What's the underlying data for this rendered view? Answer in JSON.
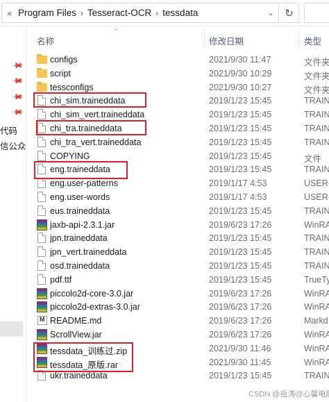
{
  "address_bar": {
    "crumbs": [
      "Program Files",
      "Tesseract-OCR",
      "tessdata"
    ],
    "back_glyph": "«",
    "separator": "›"
  },
  "nav_pane": {
    "texts": [
      "代码",
      "信公众"
    ]
  },
  "columns": {
    "name": "名称",
    "date": "修改日期",
    "type": "类型"
  },
  "files": [
    {
      "name": "configs",
      "date": "2021/9/30 11:47",
      "type": "文件夹",
      "icon": "folder-icon"
    },
    {
      "name": "script",
      "date": "2021/9/30 10:29",
      "type": "文件夹",
      "icon": "folder-icon"
    },
    {
      "name": "tessconfigs",
      "date": "2021/9/30 10:27",
      "type": "文件夹",
      "icon": "folder-icon"
    },
    {
      "name": "chi_sim.traineddata",
      "date": "2019/1/23 15:45",
      "type": "TRAIN",
      "icon": "file-icon"
    },
    {
      "name": "chi_sim_vert.traineddata",
      "date": "2019/1/23 15:45",
      "type": "TRAIN",
      "icon": "file-icon"
    },
    {
      "name": "chi_tra.traineddata",
      "date": "2019/1/23 15:45",
      "type": "TRAIN",
      "icon": "file-icon"
    },
    {
      "name": "chi_tra_vert.traineddata",
      "date": "2019/1/23 15:45",
      "type": "TRAIN",
      "icon": "file-icon"
    },
    {
      "name": "COPYING",
      "date": "2019/1/23 15:45",
      "type": "文件",
      "icon": "file-icon"
    },
    {
      "name": "eng.traineddata",
      "date": "2019/1/23 15:45",
      "type": "TRAIN",
      "icon": "file-icon"
    },
    {
      "name": "eng.user-patterns",
      "date": "2019/1/17 4:53",
      "type": "USER-",
      "icon": "file-icon"
    },
    {
      "name": "eng.user-words",
      "date": "2019/1/17 4:53",
      "type": "USER-",
      "icon": "file-icon"
    },
    {
      "name": "eus.traineddata",
      "date": "2019/1/23 15:45",
      "type": "TRAIN",
      "icon": "file-icon"
    },
    {
      "name": "jaxb-api-2.3.1.jar",
      "date": "2019/6/23 17:26",
      "type": "WinRA",
      "icon": "archive-icon"
    },
    {
      "name": "jpn.traineddata",
      "date": "2019/1/23 15:45",
      "type": "TRAIN",
      "icon": "file-icon"
    },
    {
      "name": "jpn_vert.traineddata",
      "date": "2019/1/23 15:45",
      "type": "TRAIN",
      "icon": "file-icon"
    },
    {
      "name": "osd.traineddata",
      "date": "2019/1/23 15:45",
      "type": "TRAIN",
      "icon": "file-icon"
    },
    {
      "name": "pdf.ttf",
      "date": "2019/1/23 15:45",
      "type": "TrueTy",
      "icon": "file-icon"
    },
    {
      "name": "piccolo2d-core-3.0.jar",
      "date": "2019/6/23 17:26",
      "type": "WinRA",
      "icon": "archive-icon"
    },
    {
      "name": "piccolo2d-extras-3.0.jar",
      "date": "2019/6/23 17:26",
      "type": "WinRA",
      "icon": "archive-icon"
    },
    {
      "name": "README.md",
      "date": "2019/6/23 17:26",
      "type": "Markd",
      "icon": "markdown-icon"
    },
    {
      "name": "ScrollView.jar",
      "date": "2019/6/23 17:26",
      "type": "WinRA",
      "icon": "archive-icon"
    },
    {
      "name": "tessdata_训练过.zip",
      "date": "2021/9/30 11:46",
      "type": "WinRA",
      "icon": "archive-icon"
    },
    {
      "name": "tessdata_原版.rar",
      "date": "2021/9/30 11:45",
      "type": "WinRA",
      "icon": "archive-icon"
    },
    {
      "name": "ukr.traineddata",
      "date": "2019/1/23 15:45",
      "type": "TRAIN",
      "icon": "file-icon"
    }
  ],
  "highlight_color": "#e02020",
  "watermark": "CSDN @岳涛@心馨电脑"
}
